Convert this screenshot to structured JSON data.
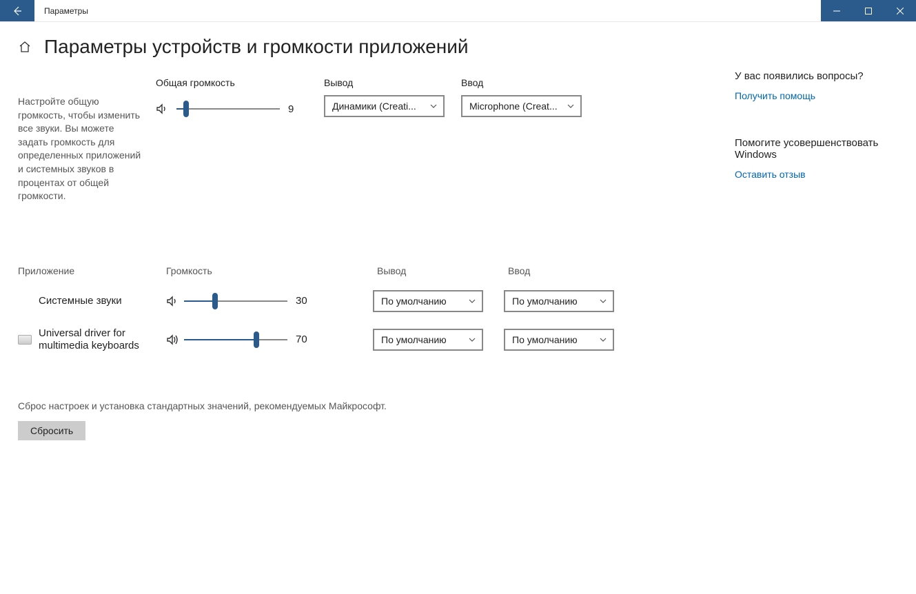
{
  "titlebar": {
    "title": "Параметры"
  },
  "page": {
    "heading": "Параметры устройств и громкости приложений",
    "description": "Настройте общую громкость, чтобы изменить все звуки. Вы можете задать громкость для определенных приложений и системных звуков в процентах от общей громкости."
  },
  "master": {
    "volume_label": "Общая громкость",
    "volume_value": 9,
    "output_label": "Вывод",
    "output_selected": "Динамики (Creati...",
    "input_label": "Ввод",
    "input_selected": "Microphone (Creat..."
  },
  "apps": {
    "col_app": "Приложение",
    "col_volume": "Громкость",
    "col_output": "Вывод",
    "col_input": "Ввод",
    "default_option": "По умолчанию",
    "rows": [
      {
        "name": "Системные звуки",
        "volume": 30,
        "output": "По умолчанию",
        "input": "По умолчанию",
        "has_icon": false
      },
      {
        "name": "Universal driver for multimedia keyboards",
        "volume": 70,
        "output": "По умолчанию",
        "input": "По умолчанию",
        "has_icon": true
      }
    ]
  },
  "reset": {
    "text": "Сброс настроек и установка стандартных значений, рекомендуемых Майкрософт.",
    "button": "Сбросить"
  },
  "sidebar": {
    "help_heading": "У вас появились вопросы?",
    "help_link": "Получить помощь",
    "feedback_heading": "Помогите усовершенствовать Windows",
    "feedback_link": "Оставить отзыв"
  }
}
